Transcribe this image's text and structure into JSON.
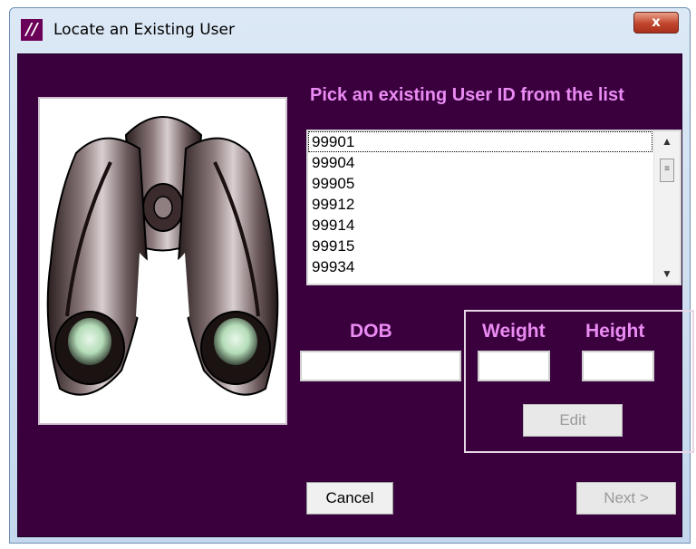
{
  "window": {
    "title": "Locate an Existing User",
    "app_icon_glyph": "//",
    "close_glyph": "x"
  },
  "prompt": "Pick an existing User ID from the list",
  "user_ids": [
    "99901",
    "99904",
    "99905",
    "99912",
    "99914",
    "99915",
    "99934"
  ],
  "selected_user_id": "99901",
  "labels": {
    "dob": "DOB",
    "weight": "Weight",
    "height": "Height"
  },
  "fields": {
    "dob": "",
    "weight": "",
    "height": ""
  },
  "buttons": {
    "edit": "Edit",
    "cancel": "Cancel",
    "next": "Next >"
  },
  "icons": {
    "picture": "binoculars-image",
    "scroll_up": "arrow-up-icon",
    "scroll_down": "arrow-down-icon"
  },
  "colors": {
    "background": "#3a003e",
    "label": "#e98bf2"
  }
}
